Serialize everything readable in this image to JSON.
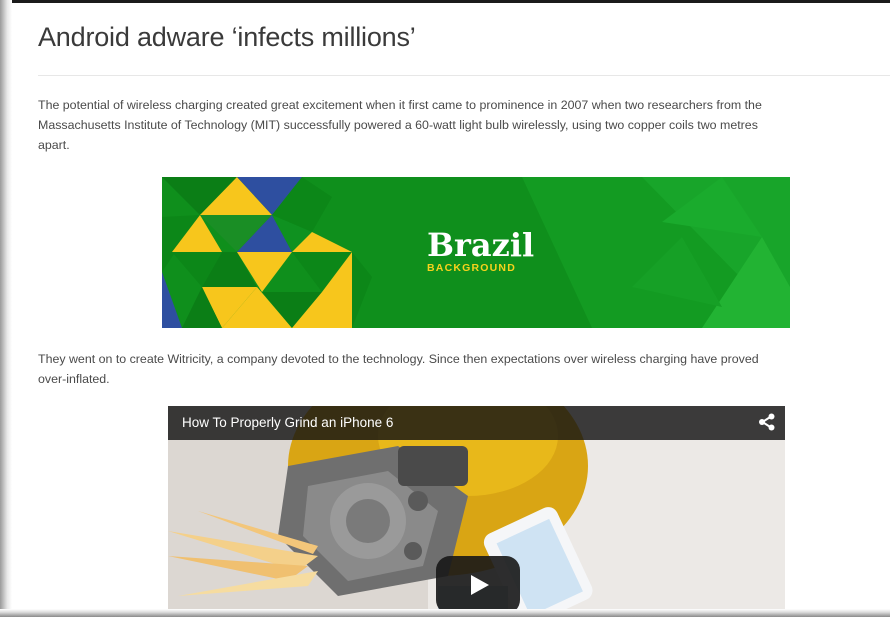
{
  "article": {
    "title": "Android adware ‘infects millions’",
    "paragraph1": [
      "The potential of wireless charging created great excitement when it first came to prominence in 2007 when two researchers from the",
      "Massachusetts Institute of Technology (MIT) successfully powered a 60-watt light bulb wirelessly, using two copper coils two metres",
      "apart."
    ],
    "paragraph2": [
      "They went on to create Witricity, a company devoted to the technology. Since then expectations over wireless charging have proved",
      "over-inflated."
    ]
  },
  "banner": {
    "main_text": "Brazil",
    "sub_text": "BACKGROUND",
    "colors": {
      "green": "#0f8f1c",
      "yellow": "#f7c61c",
      "blue": "#2e4fa0"
    }
  },
  "video": {
    "title": "How To Properly Grind an iPhone 6",
    "share_icon": "share-icon",
    "play_icon": "play-icon"
  }
}
